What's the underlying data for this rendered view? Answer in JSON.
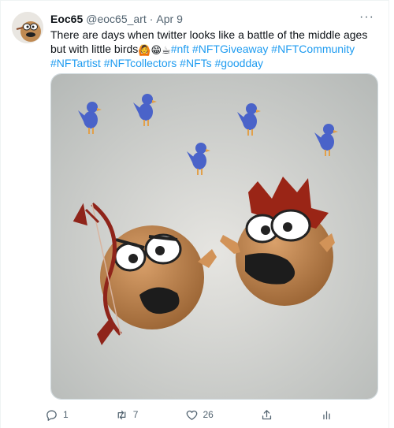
{
  "tweet": {
    "author_name": "Eoc65",
    "author_handle": "@eoc65_art",
    "separator": "·",
    "date": "Apr 9",
    "more_label": "···",
    "text_main": "There are days when twitter looks like a battle of the middle ages but with little birds",
    "emojis": [
      "🙆",
      "😁",
      "☕"
    ],
    "hashtags": [
      "#nft",
      "#NFTGiveaway",
      "#NFTCommunity",
      "#NFTartist",
      "#NFTcollectors",
      "#NFTs",
      "#goodday"
    ]
  },
  "actions": {
    "reply_count": "1",
    "retweet_count": "7",
    "like_count": "26"
  },
  "colors": {
    "link": "#1d9bf0",
    "secondary_text": "#536471",
    "primary_text": "#0f1419"
  },
  "icons": [
    "reply-icon",
    "retweet-icon",
    "like-icon",
    "share-icon",
    "analytics-icon",
    "more-icon"
  ]
}
